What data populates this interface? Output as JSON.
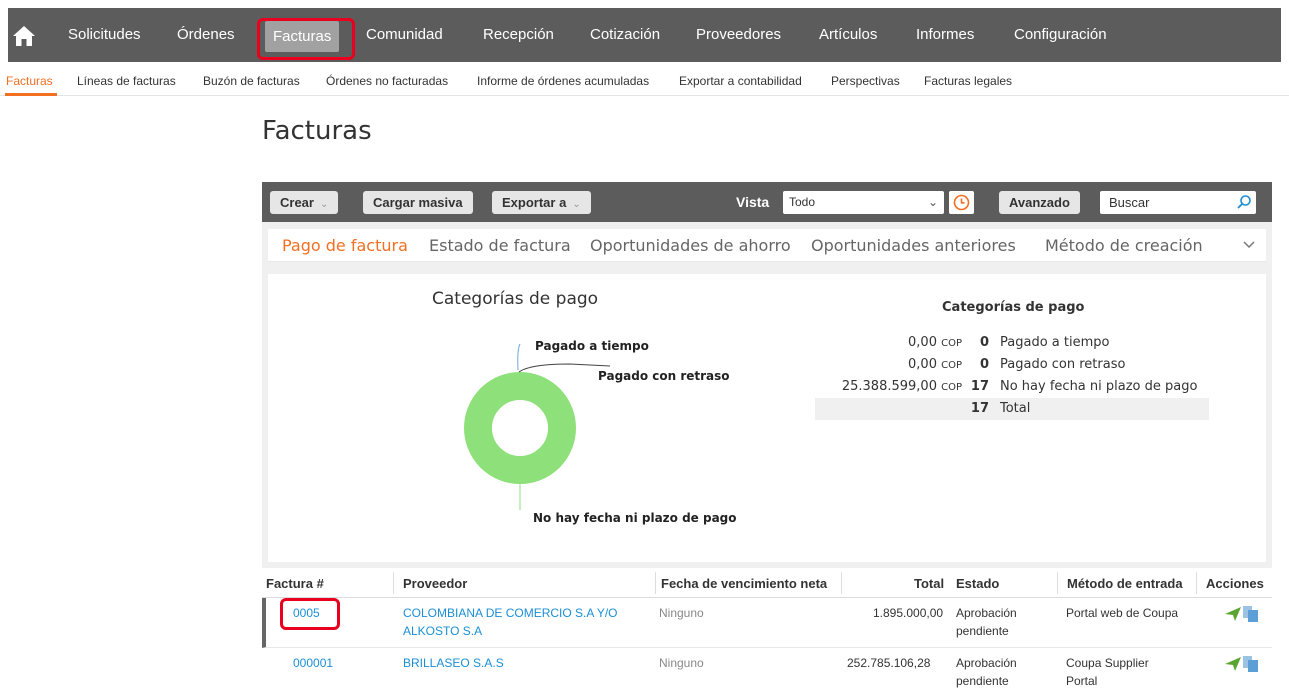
{
  "topnav": {
    "items": [
      {
        "label": "Solicitudes"
      },
      {
        "label": "Órdenes"
      },
      {
        "label": "Facturas",
        "active": true
      },
      {
        "label": "Comunidad"
      },
      {
        "label": "Recepción"
      },
      {
        "label": "Cotización"
      },
      {
        "label": "Proveedores"
      },
      {
        "label": "Artículos"
      },
      {
        "label": "Informes"
      },
      {
        "label": "Configuración"
      }
    ]
  },
  "subnav": {
    "items": [
      {
        "label": "Facturas",
        "active": true
      },
      {
        "label": "Líneas de facturas"
      },
      {
        "label": "Buzón de facturas"
      },
      {
        "label": "Órdenes no facturadas"
      },
      {
        "label": "Informe de órdenes acumuladas"
      },
      {
        "label": "Exportar a contabilidad"
      },
      {
        "label": "Perspectivas"
      },
      {
        "label": "Facturas legales"
      }
    ]
  },
  "page": {
    "title": "Facturas"
  },
  "toolbar": {
    "create_label": "Crear",
    "bulk_upload_label": "Cargar masiva",
    "export_label": "Exportar a",
    "view_label": "Vista",
    "view_value": "Todo",
    "advanced_label": "Avanzado",
    "search_placeholder": "Buscar"
  },
  "tabs": [
    {
      "label": "Pago de factura",
      "active": true
    },
    {
      "label": "Estado de factura"
    },
    {
      "label": "Oportunidades de ahorro"
    },
    {
      "label": "Oportunidades anteriores"
    },
    {
      "label": "Método de creación"
    }
  ],
  "chart_data": {
    "type": "pie",
    "title": "Categorías de pago",
    "categories": [
      "Pagado a tiempo",
      "Pagado con retraso",
      "No hay fecha ni plazo de pago"
    ],
    "values": [
      0,
      0,
      17
    ],
    "colors": [
      "#6fa8dc",
      "#444444",
      "#8ee07a"
    ],
    "donut": true
  },
  "summary": {
    "title": "Categorías de pago",
    "rows": [
      {
        "amount": "0,00",
        "currency": "COP",
        "count": "0",
        "label": "Pagado a tiempo"
      },
      {
        "amount": "0,00",
        "currency": "COP",
        "count": "0",
        "label": "Pagado con retraso"
      },
      {
        "amount": "25.388.599,00",
        "currency": "COP",
        "count": "17",
        "label": "No hay fecha ni plazo de pago"
      }
    ],
    "total": {
      "count": "17",
      "label": "Total"
    }
  },
  "table": {
    "columns": [
      "Factura #",
      "Proveedor",
      "Fecha de vencimiento neta",
      "Total",
      "Estado",
      "Método de entrada",
      "Acciones"
    ],
    "rows": [
      {
        "invoice": "0005",
        "supplier_1": "COLOMBIANA DE COMERCIO S.A Y/O",
        "supplier_2": "ALKOSTO S.A",
        "due": "Ninguno",
        "total": "1.895.000,00",
        "status_1": "Aprobación",
        "status_2": "pendiente",
        "method_1": "Portal web de Coupa",
        "method_2": ""
      },
      {
        "invoice": "000001",
        "supplier_1": "BRILLASEO S.A.S",
        "supplier_2": "",
        "due": "Ninguno",
        "total": "252.785.106,28",
        "status_1": "Aprobación",
        "status_2": "pendiente",
        "method_1": "Coupa Supplier",
        "method_2": "Portal"
      }
    ]
  },
  "colors": {
    "nav_bg": "#5c5c5c",
    "accent_orange": "#f26f21",
    "link_blue": "#1a8fd6",
    "highlight_red": "#e8001e",
    "action_green": "#5aa531"
  }
}
